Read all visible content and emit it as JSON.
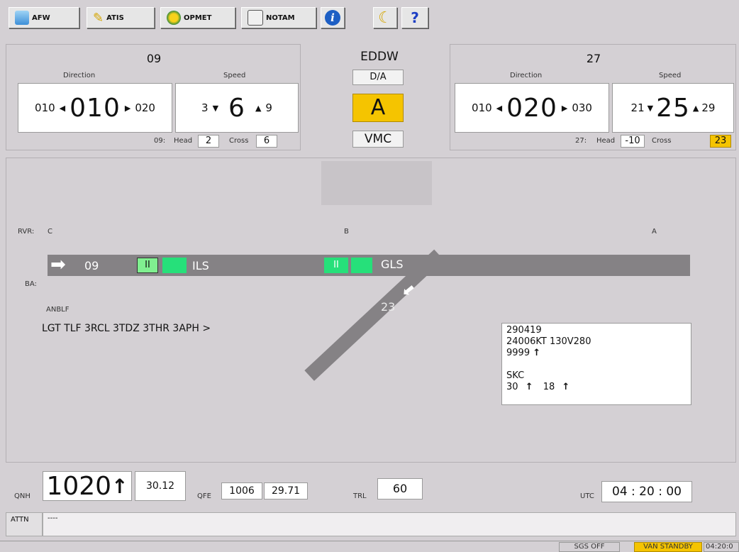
{
  "toolbar": {
    "buttons": [
      {
        "label": "AFW"
      },
      {
        "label": "ATIS"
      },
      {
        "label": "OPMET"
      },
      {
        "label": "NOTAM"
      }
    ],
    "info_symbol": "i",
    "moon_symbol": "☾",
    "help_symbol": "?"
  },
  "left_panel": {
    "runway": "09",
    "direction_label": "Direction",
    "speed_label": "Speed",
    "dir_min": "010",
    "dir_value": "010",
    "dir_max": "020",
    "spd_min": "3",
    "spd_value": "6",
    "spd_max": "9",
    "comp_prefix": "09:",
    "head_label": "Head",
    "head_value": "2",
    "cross_label": "Cross",
    "cross_value": "6"
  },
  "center_panel": {
    "station": "EDDW",
    "da_label": "D/A",
    "category": "A",
    "conditions": "VMC"
  },
  "right_panel": {
    "runway": "27",
    "direction_label": "Direction",
    "speed_label": "Speed",
    "dir_min": "010",
    "dir_value": "020",
    "dir_max": "030",
    "spd_min": "21",
    "spd_value": "25",
    "spd_max": "29",
    "comp_prefix": "27:",
    "head_label": "Head",
    "head_value": "-10",
    "cross_label": "Cross",
    "cross_value": "23"
  },
  "runway_view": {
    "rvr_label": "RVR:",
    "rvr_c": "C",
    "rvr_b": "B",
    "rvr_a": "A",
    "ba_label": "BA:",
    "rwy_09": "09",
    "cat_ii": "II",
    "ils_label": "ILS",
    "gls_label": "GLS",
    "rwy_23": "23",
    "anblf_label": "ANBLF",
    "lights_text": "LGT TLF 3RCL 3TDZ 3THR 3APH >"
  },
  "metar": {
    "line1": "290419",
    "line2": "24006KT 130V280",
    "line3_value": "9999",
    "line4": "SKC",
    "temp": "30",
    "dew": "18",
    "trend_arrow": "↑"
  },
  "bottom": {
    "qnh_label": "QNH",
    "qnh_value": "1020",
    "qnh_arrow": "↑",
    "qnh_inhg": "30.12",
    "qfe_label": "QFE",
    "qfe_value": "1006",
    "qfe_inhg": "29.71",
    "trl_label": "TRL",
    "trl_value": "60",
    "utc_label": "UTC",
    "utc_value": "04 : 20 : 00"
  },
  "attn": {
    "label": "ATTN",
    "text": "----"
  },
  "status_bar": {
    "sgs": "SGS OFF",
    "standby": "VAN STANDBY",
    "time": "04:20:0"
  },
  "colors": {
    "accent_yellow": "#f5c400",
    "light_green": "#26e07a",
    "runway_grey": "#858285"
  }
}
